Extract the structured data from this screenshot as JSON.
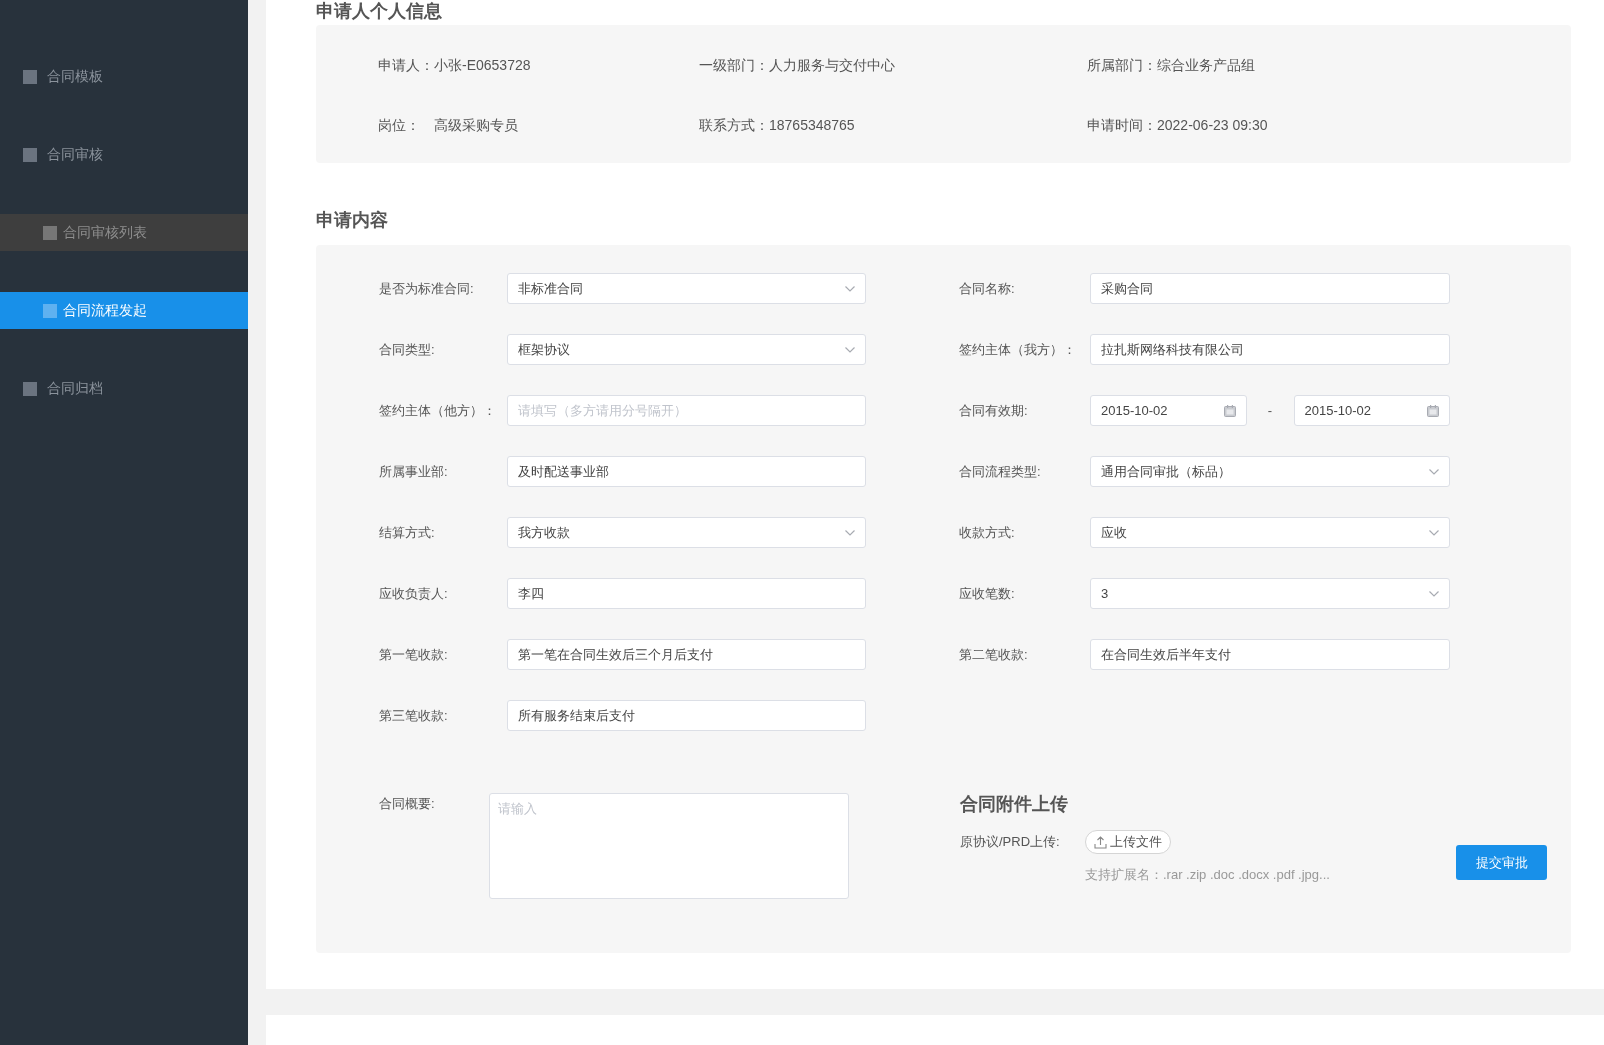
{
  "sidebar": {
    "items": [
      {
        "label": "合同模板",
        "selected": false,
        "hovered": false
      },
      {
        "label": "合同审核",
        "selected": false,
        "hovered": false,
        "children": [
          {
            "label": "合同审核列表",
            "selected": false,
            "hovered": true
          },
          {
            "label": "合同流程发起",
            "selected": true,
            "hovered": false
          }
        ]
      },
      {
        "label": "合同归档",
        "selected": false,
        "hovered": false
      }
    ]
  },
  "applicant_info": {
    "title": "申请人个人信息",
    "fields": [
      {
        "label": "申请人：",
        "value": "小张-E0653728"
      },
      {
        "label": "一级部门：",
        "value": "人力服务与交付中心"
      },
      {
        "label": "所属部门：",
        "value": "综合业务产品组"
      },
      {
        "label": "岗位：",
        "value": "高级采购专员"
      },
      {
        "label": "联系方式：",
        "value": "18765348765"
      },
      {
        "label": "申请时间：",
        "value": "2022-06-23 09:30"
      }
    ]
  },
  "application_content": {
    "title": "申请内容",
    "rows": [
      [
        {
          "kind": "select",
          "label": "是否为标准合同:",
          "value": "非标准合同"
        },
        {
          "kind": "text",
          "label": "合同名称:",
          "value": "采购合同"
        }
      ],
      [
        {
          "kind": "select",
          "label": "合同类型:",
          "value": "框架协议"
        },
        {
          "kind": "text",
          "label": "签约主体（我方）：",
          "value": "拉扎斯网络科技有限公司"
        }
      ],
      [
        {
          "kind": "text",
          "label": "签约主体（他方）：",
          "placeholder": "请填写（多方请用分号隔开）"
        },
        {
          "kind": "date_range",
          "label": "合同有效期:",
          "start": "2015-10-02",
          "separator": "-",
          "end": "2015-10-02"
        }
      ],
      [
        {
          "kind": "text",
          "label": "所属事业部:",
          "value": "及时配送事业部"
        },
        {
          "kind": "select",
          "label": "合同流程类型:",
          "value": "通用合同审批（标品）"
        }
      ],
      [
        {
          "kind": "select",
          "label": "结算方式:",
          "value": "我方收款"
        },
        {
          "kind": "select",
          "label": "收款方式:",
          "value": "应收"
        }
      ],
      [
        {
          "kind": "text",
          "label": "应收负责人:",
          "value": "李四"
        },
        {
          "kind": "select",
          "label": "应收笔数:",
          "value": "3"
        }
      ],
      [
        {
          "kind": "text",
          "label": "第一笔收款:",
          "value": "第一笔在合同生效后三个月后支付"
        },
        {
          "kind": "text",
          "label": "第二笔收款:",
          "value": "在合同生效后半年支付"
        }
      ],
      [
        {
          "kind": "text",
          "label": "第三笔收款:",
          "value": "所有服务结束后支付"
        }
      ]
    ],
    "summary": {
      "label": "合同概要:",
      "placeholder": "请输入"
    },
    "attachments": {
      "title": "合同附件上传",
      "label": "原协议/PRD上传:",
      "upload_button": "上传文件",
      "hint": "支持扩展名：.rar .zip .doc .docx .pdf .jpg..."
    },
    "submit_button": "提交审批"
  }
}
